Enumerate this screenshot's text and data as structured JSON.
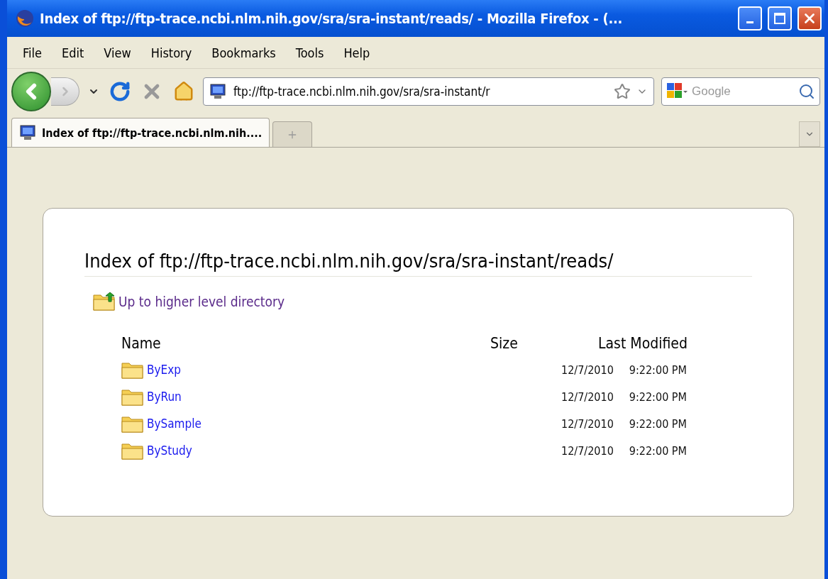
{
  "window": {
    "title": "Index of ftp://ftp-trace.ncbi.nlm.nih.gov/sra/sra-instant/reads/ - Mozilla Firefox - (..."
  },
  "menu": [
    "File",
    "Edit",
    "View",
    "History",
    "Bookmarks",
    "Tools",
    "Help"
  ],
  "address_bar": {
    "value": "ftp://ftp-trace.ncbi.nlm.nih.gov/sra/sra-instant/r"
  },
  "search": {
    "placeholder": "Google"
  },
  "tabs": [
    {
      "label": "Index of ftp://ftp-trace.ncbi.nlm.nih....",
      "selected": true
    }
  ],
  "page": {
    "heading": "Index of ftp://ftp-trace.ncbi.nlm.nih.gov/sra/sra-instant/reads/",
    "up_link": "Up to higher level directory",
    "columns": [
      "Name",
      "Size",
      "Last Modified"
    ],
    "rows": [
      {
        "name": "ByExp",
        "date": "12/7/2010",
        "time": "9:22:00 PM"
      },
      {
        "name": "ByRun",
        "date": "12/7/2010",
        "time": "9:22:00 PM"
      },
      {
        "name": "BySample",
        "date": "12/7/2010",
        "time": "9:22:00 PM"
      },
      {
        "name": "ByStudy",
        "date": "12/7/2010",
        "time": "9:22:00 PM"
      }
    ]
  }
}
